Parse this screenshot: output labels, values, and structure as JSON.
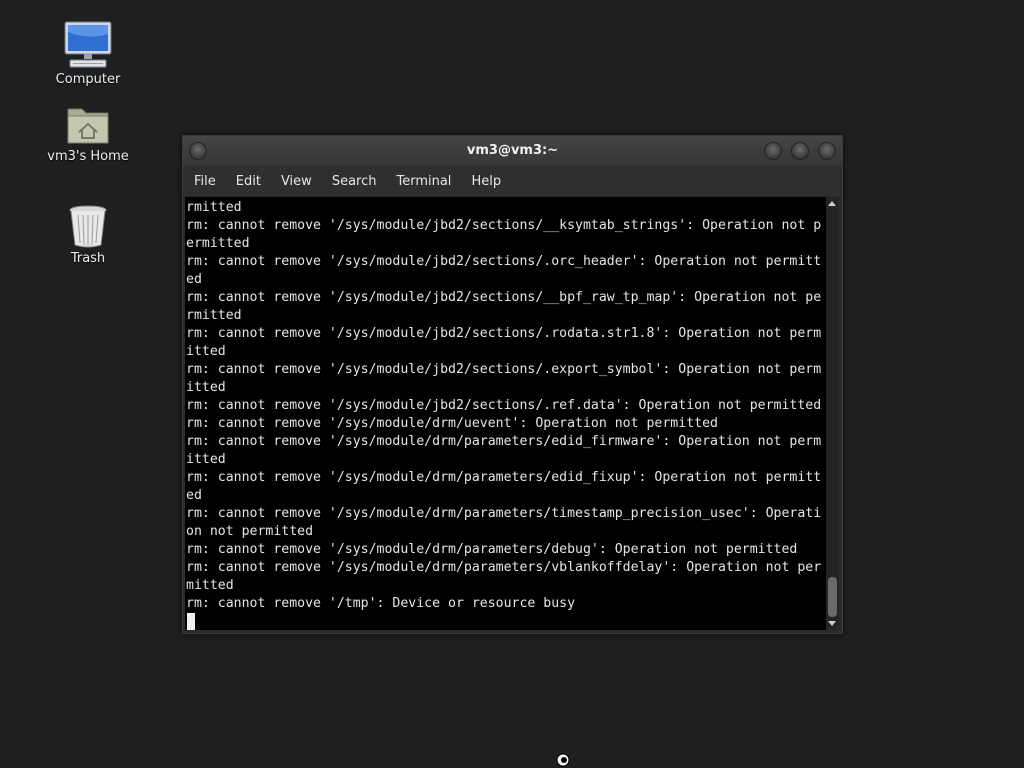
{
  "desktop": {
    "icons": [
      {
        "label": "Computer",
        "icon": "computer-icon"
      },
      {
        "label": "vm3's Home",
        "icon": "home-folder-icon"
      },
      {
        "label": "Trash",
        "icon": "trash-icon"
      }
    ]
  },
  "window": {
    "title": "vm3@vm3:~",
    "menu": [
      "File",
      "Edit",
      "View",
      "Search",
      "Terminal",
      "Help"
    ],
    "terminal_lines": [
      "rmitted",
      "rm: cannot remove '/sys/module/jbd2/sections/__ksymtab_strings': Operation not p",
      "ermitted",
      "rm: cannot remove '/sys/module/jbd2/sections/.orc_header': Operation not permitt",
      "ed",
      "rm: cannot remove '/sys/module/jbd2/sections/__bpf_raw_tp_map': Operation not pe",
      "rmitted",
      "rm: cannot remove '/sys/module/jbd2/sections/.rodata.str1.8': Operation not perm",
      "itted",
      "rm: cannot remove '/sys/module/jbd2/sections/.export_symbol': Operation not perm",
      "itted",
      "rm: cannot remove '/sys/module/jbd2/sections/.ref.data': Operation not permitted",
      "rm: cannot remove '/sys/module/drm/uevent': Operation not permitted",
      "rm: cannot remove '/sys/module/drm/parameters/edid_firmware': Operation not perm",
      "itted",
      "rm: cannot remove '/sys/module/drm/parameters/edid_fixup': Operation not permitt",
      "ed",
      "rm: cannot remove '/sys/module/drm/parameters/timestamp_precision_usec': Operati",
      "on not permitted",
      "rm: cannot remove '/sys/module/drm/parameters/debug': Operation not permitted",
      "rm: cannot remove '/sys/module/drm/parameters/vblankoffdelay': Operation not per",
      "mitted",
      "rm: cannot remove '/tmp': Device or resource busy"
    ]
  },
  "colors": {
    "desktop_bg": "#1f1f1f",
    "terminal_bg": "#000000",
    "terminal_fg": "#e5e5e5"
  }
}
